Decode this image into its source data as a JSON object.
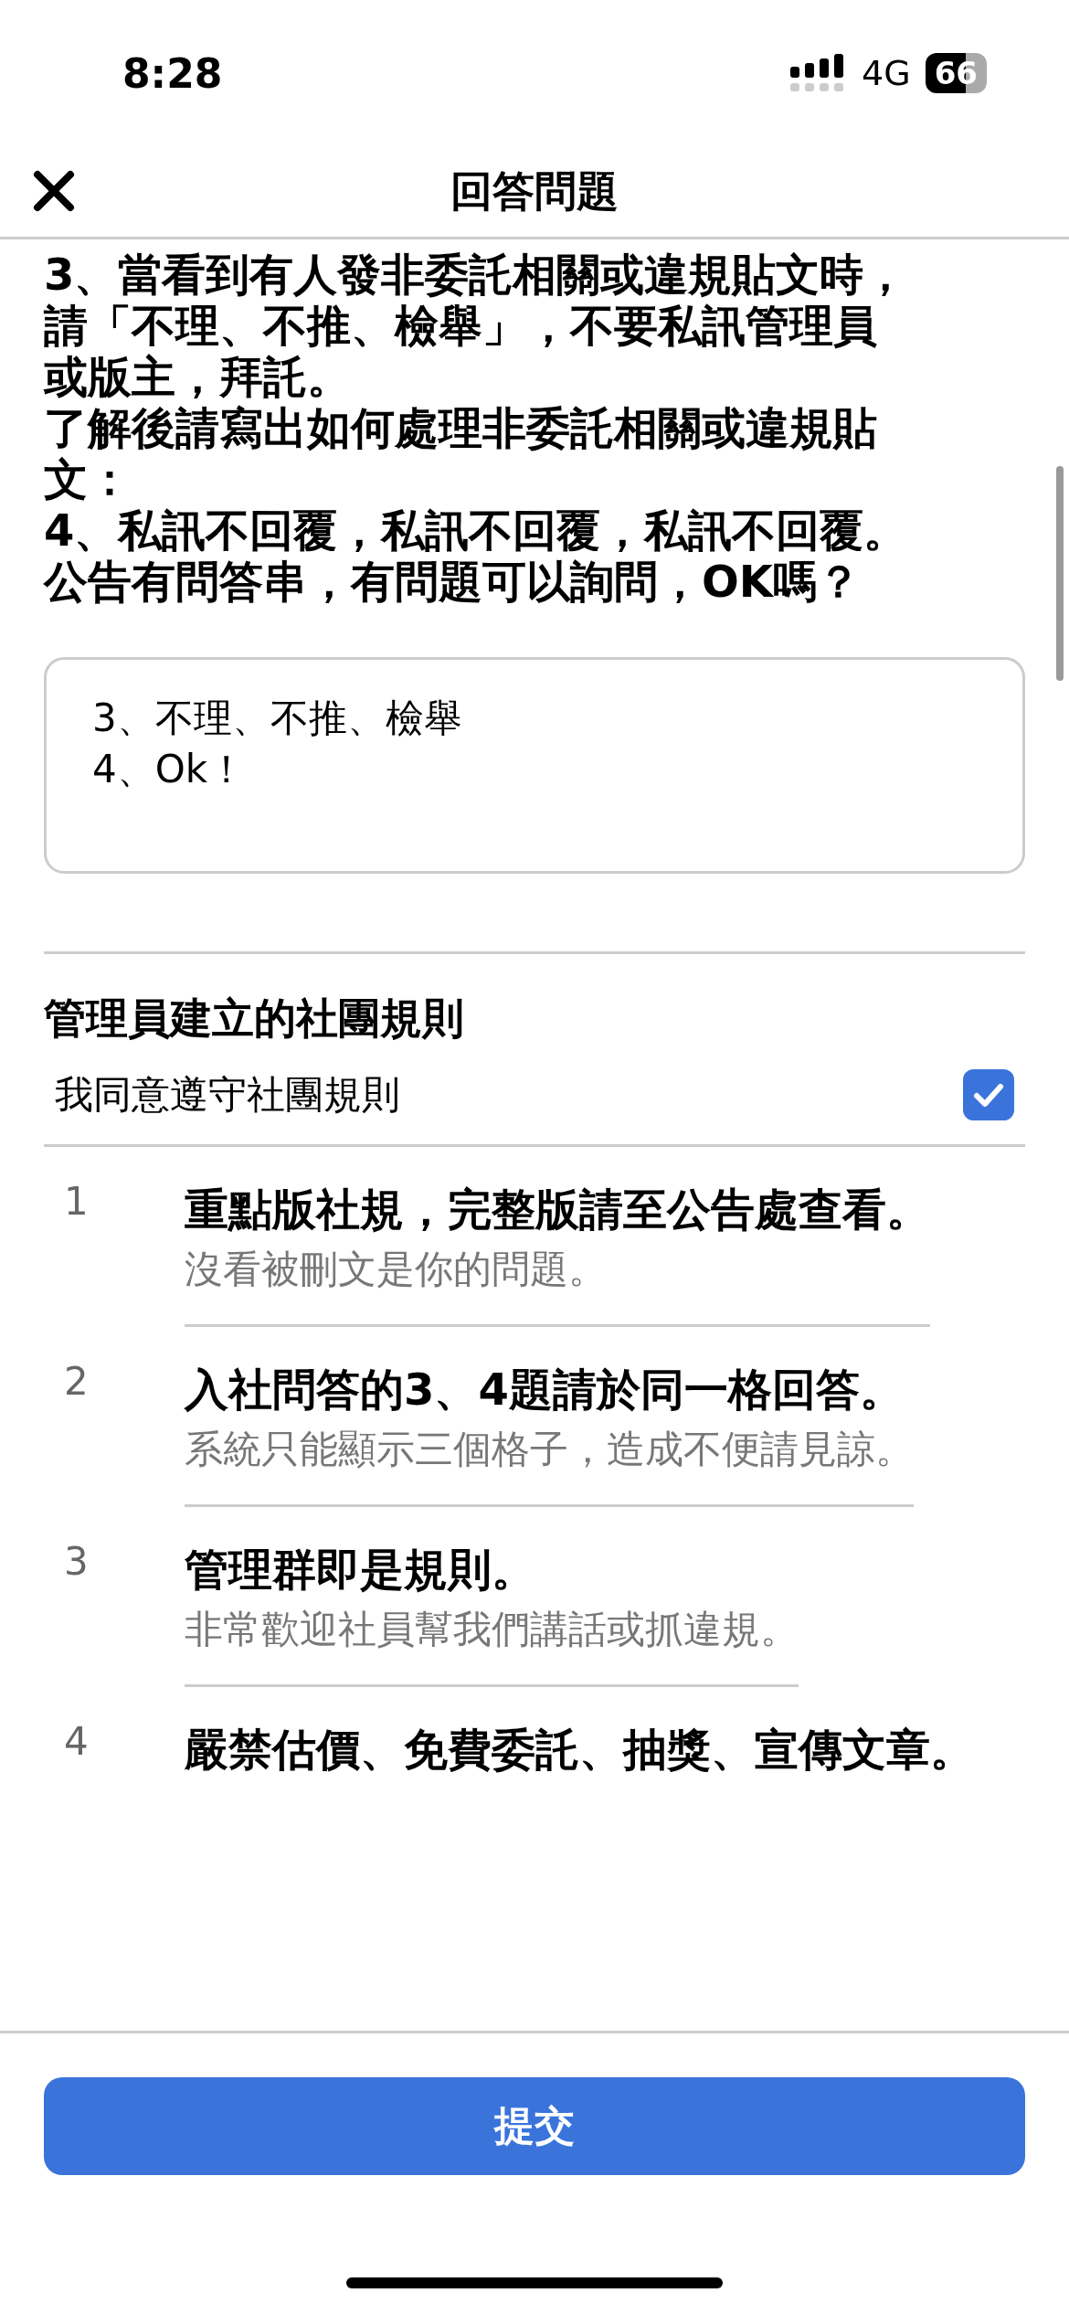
{
  "status_bar": {
    "time": "8:28",
    "network": "4G",
    "battery": "66"
  },
  "header": {
    "title": "回答問題"
  },
  "questions": [
    {
      "lines": [
        "3、當看到有人發非委託相關或違規貼文時，",
        "請「不理、不推、檢舉」，不要私訊管理員",
        "或版主，拜託。",
        "了解後請寫出如何處理非委託相關或違規貼",
        "文："
      ]
    },
    {
      "lines": [
        "4、私訊不回覆，私訊不回覆，私訊不回覆。",
        "公告有問答串，有問題可以詢問，OK嗎？"
      ],
      "answer": "3、不理、不推、檢舉\n4、Ok！"
    }
  ],
  "rules_section": {
    "title": "管理員建立的社團規則",
    "agreement": {
      "label": "我同意遵守社團規則",
      "checked": true
    },
    "rules": [
      {
        "number": "1",
        "title": "重點版社規，完整版請至公告處查看。",
        "detail": "沒看被刪文是你的問題。"
      },
      {
        "number": "2",
        "title": "入社問答的3、4題請於同一格回答。",
        "detail": "系統只能顯示三個格子，造成不便請見諒。"
      },
      {
        "number": "3",
        "title": "管理群即是規則。",
        "detail": "非常歡迎社員幫我們講話或抓違規。"
      },
      {
        "number": "4",
        "title": "嚴禁估價、免費委託、抽獎、宣傳文章。"
      }
    ]
  },
  "submit_button": "提交"
}
